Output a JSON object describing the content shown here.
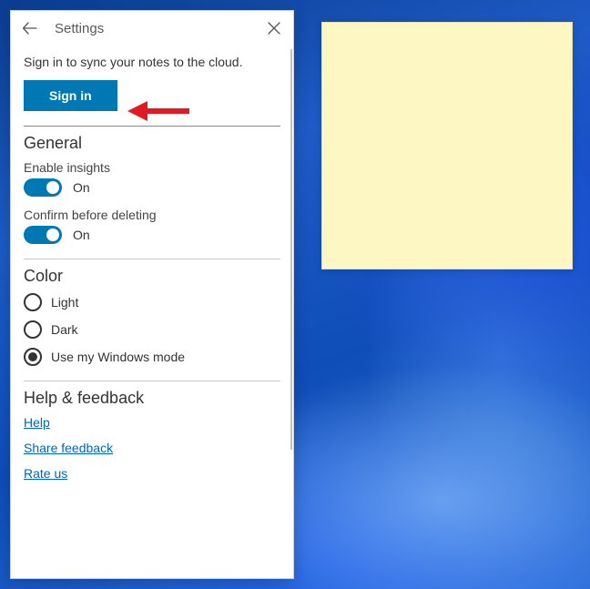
{
  "settings": {
    "title": "Settings",
    "sync_prompt": "Sign in to sync your notes to the cloud.",
    "sign_in_label": "Sign in",
    "sections": {
      "general": {
        "title": "General",
        "insights": {
          "label": "Enable insights",
          "state": "On"
        },
        "confirm_delete": {
          "label": "Confirm before deleting",
          "state": "On"
        }
      },
      "color": {
        "title": "Color",
        "options": {
          "light": "Light",
          "dark": "Dark",
          "windows": "Use my Windows mode"
        },
        "selected": "windows"
      },
      "help": {
        "title": "Help & feedback",
        "links": {
          "help": "Help",
          "feedback": "Share feedback",
          "rate": "Rate us"
        }
      }
    }
  },
  "colors": {
    "accent": "#0078b3",
    "note_bg": "#fdf7c3",
    "arrow": "#e01b24"
  }
}
